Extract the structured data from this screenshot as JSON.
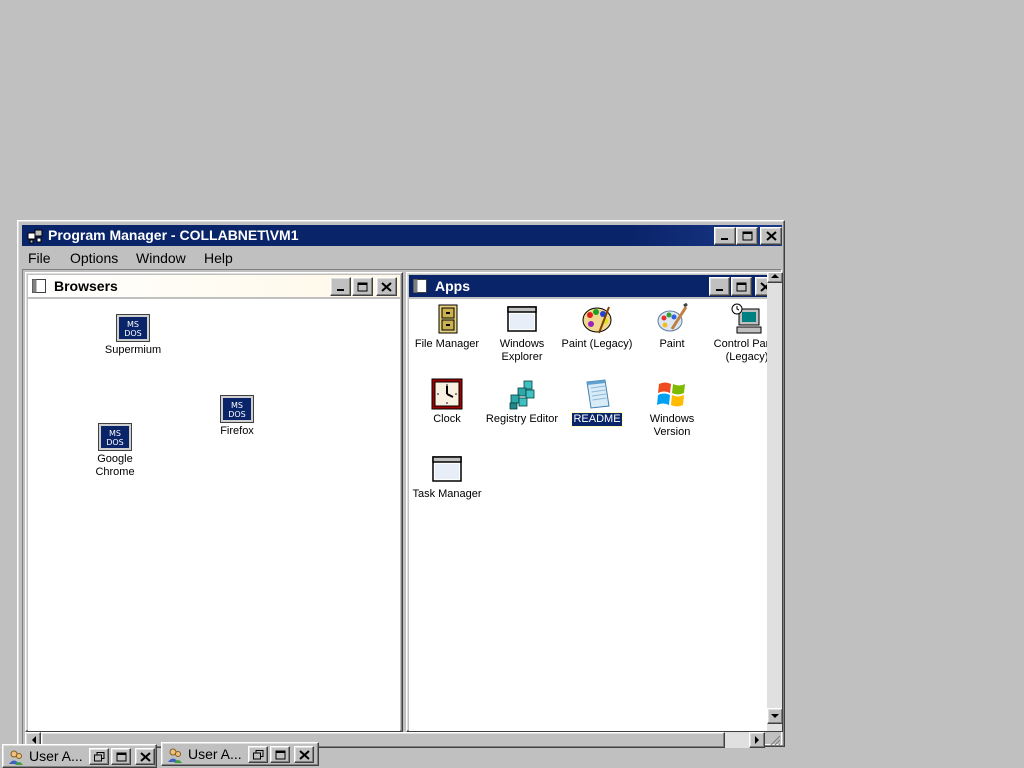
{
  "window": {
    "title": "Program Manager - COLLABNET\\VM1"
  },
  "menu": [
    "File",
    "Options",
    "Window",
    "Help"
  ],
  "browsers": {
    "title": "Browsers",
    "icons": [
      {
        "label": "Supermium",
        "badge": "MS\nDOS"
      },
      {
        "label": "Firefox",
        "badge": "MS\nDOS"
      },
      {
        "label": "Google\nChrome",
        "badge": "MS\nDOS"
      }
    ]
  },
  "apps": {
    "title": "Apps",
    "icons": [
      {
        "label": "File Manager",
        "icon": "file-cabinet-icon"
      },
      {
        "label": "Windows\nExplorer",
        "icon": "window-icon"
      },
      {
        "label": "Paint (Legacy)",
        "icon": "palette-icon"
      },
      {
        "label": "Paint",
        "icon": "palette-brush-icon"
      },
      {
        "label": "Control Panel\n(Legacy)",
        "icon": "control-panel-icon"
      },
      {
        "label": "Clock",
        "icon": "clock-icon"
      },
      {
        "label": "Registry Editor",
        "icon": "registry-cubes-icon"
      },
      {
        "label": "README",
        "icon": "notepad-icon",
        "selected": true
      },
      {
        "label": "Windows\nVersion",
        "icon": "windows-logo-icon"
      },
      {
        "label": "Task Manager",
        "icon": "window-icon"
      }
    ]
  },
  "taskbar": {
    "items": [
      {
        "label": "User A..."
      },
      {
        "label": "User A..."
      }
    ]
  },
  "colors": {
    "active_title": "#0a246a",
    "face": "#c0c0c0",
    "selection": "#0a246a"
  }
}
